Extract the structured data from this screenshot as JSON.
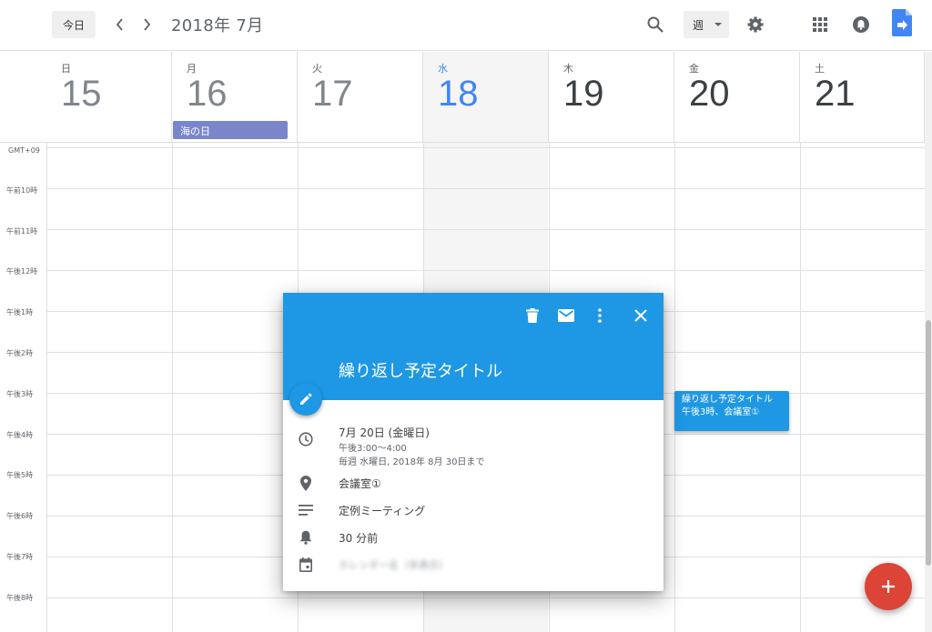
{
  "topbar": {
    "today_label": "今日",
    "prev_icon": "chevron-left-icon",
    "next_icon": "chevron-right-icon",
    "month_title": "2018年 7月",
    "view_label": "週",
    "icons": [
      "search-icon",
      "settings-gear-icon",
      "apps-grid-icon",
      "notifications-icon",
      "calendar-app-icon"
    ]
  },
  "calendar": {
    "gmt_label": "GMT+09",
    "days": [
      {
        "dow": "日",
        "num": "15"
      },
      {
        "dow": "月",
        "num": "16"
      },
      {
        "dow": "火",
        "num": "17"
      },
      {
        "dow": "水",
        "num": "18"
      },
      {
        "dow": "木",
        "num": "19"
      },
      {
        "dow": "金",
        "num": "20"
      },
      {
        "dow": "土",
        "num": "21"
      }
    ],
    "today_index": 3,
    "allday_event": {
      "label": "海の日"
    },
    "time_labels": [
      "午前10時",
      "午前11時",
      "午後12時",
      "午後1時",
      "午後2時",
      "午後3時",
      "午後4時",
      "午後5時",
      "午後6時",
      "午後7時",
      "午後8時"
    ],
    "event": {
      "title": "繰り返し予定タイトル",
      "time_place": "午後3時、会議室①"
    }
  },
  "popup": {
    "header_icons": [
      "delete-icon",
      "email-icon",
      "more-vert-icon",
      "close-icon"
    ],
    "title": "繰り返し予定タイトル",
    "date": "7月 20日 (金曜日)",
    "time": "午後3:00～4:00",
    "recurrence": "毎週 水曜日, 2018年 8月 30日まで",
    "location": "会議室①",
    "description": "定例ミーティング",
    "reminder": "30 分前",
    "calendar_owner": "カレンダー名（非表示）"
  },
  "colors": {
    "accent": "#1e98e4",
    "today": "#4285f4",
    "holiday": "#7986cb",
    "fab": "#db4437"
  }
}
